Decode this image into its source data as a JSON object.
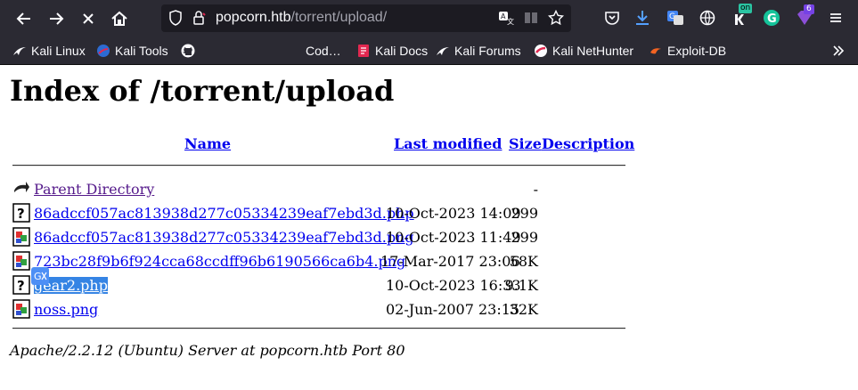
{
  "browser": {
    "url_host": "popcorn.htb",
    "url_path": "/torrent/upload/",
    "badges": {
      "on": "on",
      "count": "6"
    }
  },
  "bookmarks": [
    {
      "label": "Kali Linux",
      "icon": "kali-dragon-icon"
    },
    {
      "label": "Kali Tools",
      "icon": "kali-tools-icon"
    },
    {
      "label": "",
      "icon": "github-icon"
    },
    {
      "label": "Cod…",
      "icon": ""
    },
    {
      "label": "Kali Docs",
      "icon": "kali-docs-icon"
    },
    {
      "label": "Kali Forums",
      "icon": "kali-forums-icon"
    },
    {
      "label": "Kali NetHunter",
      "icon": "nethunter-icon"
    },
    {
      "label": "Exploit-DB",
      "icon": "exploit-db-icon"
    }
  ],
  "page": {
    "title": "Index of /torrent/upload",
    "columns": {
      "name": "Name",
      "last_modified": "Last modified",
      "size": "Size",
      "description": "Description"
    },
    "rows": [
      {
        "name": "Parent Directory",
        "modified": "",
        "size": "-",
        "icon": "back-icon"
      },
      {
        "name": "86adccf057ac813938d277c05334239eaf7ebd3d.php",
        "modified": "10-Oct-2023 14:09",
        "size": "299",
        "icon": "unknown-file-icon"
      },
      {
        "name": "86adccf057ac813938d277c05334239eaf7ebd3d.png",
        "modified": "10-Oct-2023 11:49",
        "size": "299",
        "icon": "image-file-icon"
      },
      {
        "name": "723bc28f9b6f924cca68ccdff96b6190566ca6b4.png",
        "modified": "17-Mar-2017 23:06",
        "size": "58K",
        "icon": "image-file-icon"
      },
      {
        "name": "gear2.php",
        "modified": "10-Oct-2023 16:33",
        "size": "9.1K",
        "icon": "unknown-file-icon"
      },
      {
        "name": "noss.png",
        "modified": "02-Jun-2007 23:15",
        "size": "32K",
        "icon": "image-file-icon"
      }
    ],
    "address": "Apache/2.2.12 (Ubuntu) Server at popcorn.htb Port 80"
  },
  "colors": {
    "chrome": "#2b2a33",
    "link": "#0000ee",
    "visited": "#551a8b",
    "selection": "#3584e4"
  }
}
